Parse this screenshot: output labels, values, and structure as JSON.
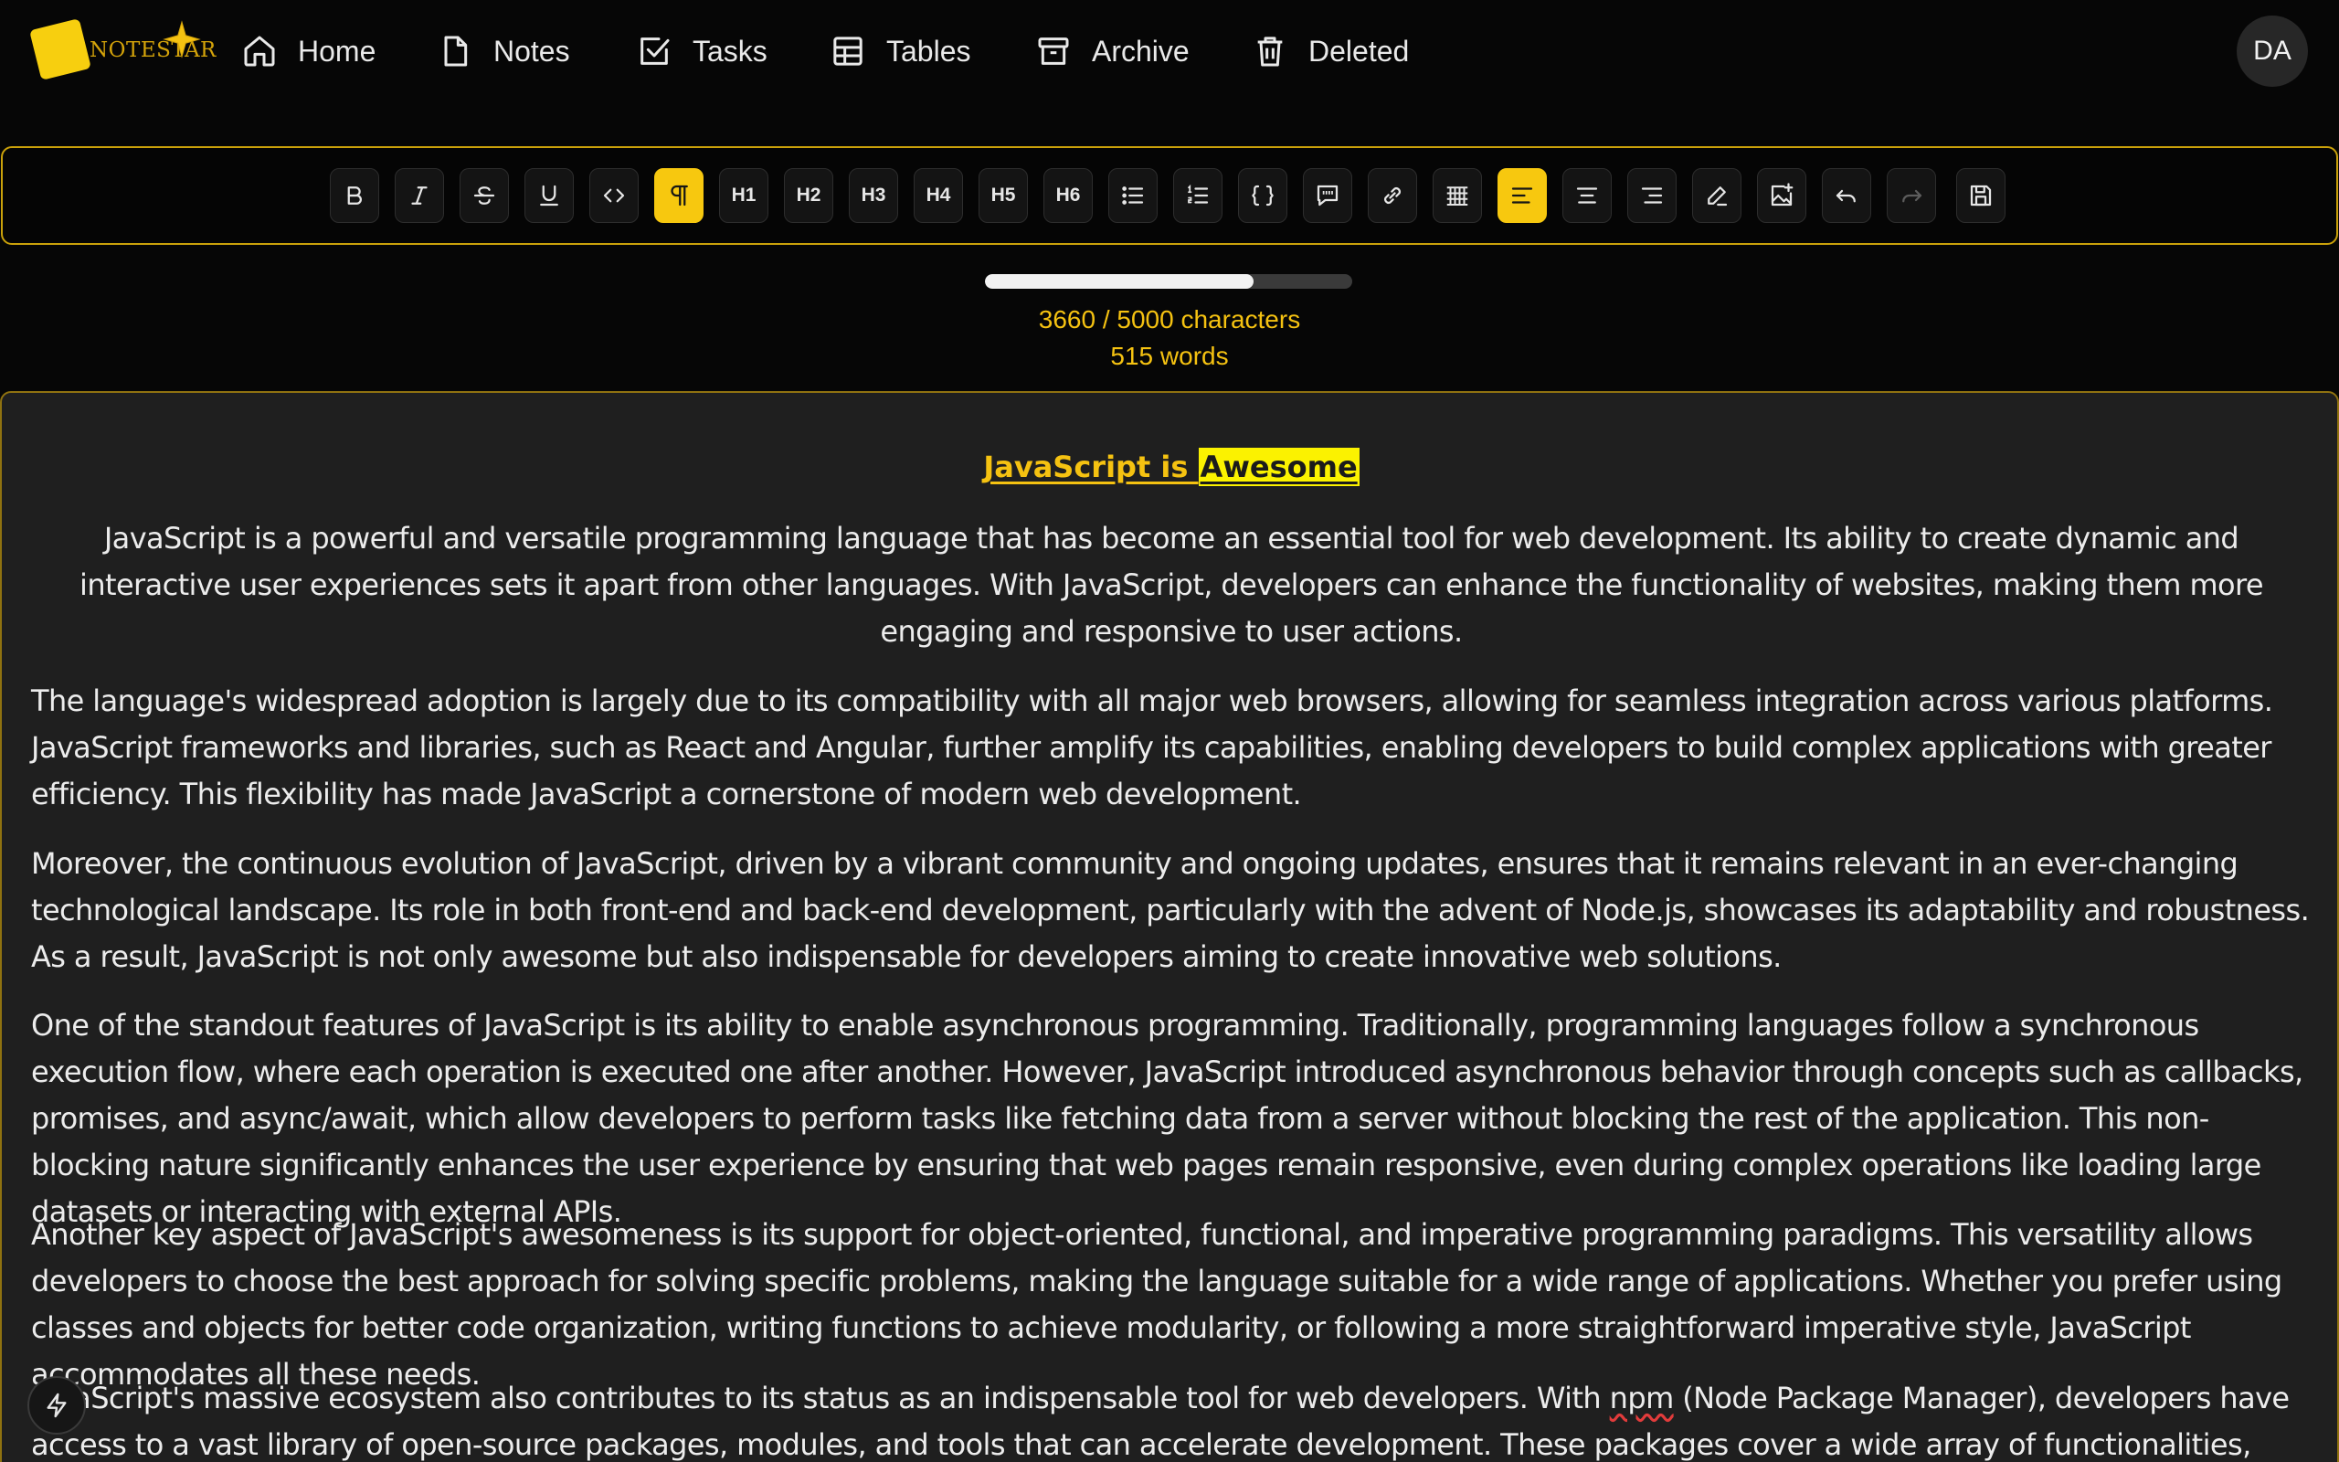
{
  "app": {
    "logo_text": "NOTESTAR",
    "avatar": "DA"
  },
  "nav": [
    {
      "label": "Home",
      "icon": "home-icon"
    },
    {
      "label": "Notes",
      "icon": "note-icon"
    },
    {
      "label": "Tasks",
      "icon": "checkbox-icon"
    },
    {
      "label": "Tables",
      "icon": "table-icon"
    },
    {
      "label": "Archive",
      "icon": "archive-icon"
    },
    {
      "label": "Deleted",
      "icon": "trash-icon"
    }
  ],
  "toolbar": {
    "buttons": [
      "bold",
      "italic",
      "strikethrough",
      "underline",
      "code",
      "paragraph",
      "h1",
      "h2",
      "h3",
      "h4",
      "h5",
      "h6",
      "bullet-list",
      "ordered-list",
      "code-block",
      "blockquote",
      "link",
      "table",
      "align-left",
      "align-center",
      "align-right",
      "highlight",
      "insert-image",
      "undo",
      "redo",
      "save"
    ],
    "headings": [
      "H1",
      "H2",
      "H3",
      "H4",
      "H5",
      "H6"
    ],
    "active": [
      "paragraph",
      "align-left"
    ],
    "disabled": [
      "redo"
    ]
  },
  "stats": {
    "characters_used": 3660,
    "characters_max": 5000,
    "characters_text": "3660 / 5000 characters",
    "words_text": "515 words",
    "progress_fraction": 0.732
  },
  "document": {
    "title_part1": "JavaScript is ",
    "title_highlight": "Awesome",
    "intro": "JavaScript is a powerful and versatile programming language that has become an essential tool for web development. Its ability to create dynamic and interactive user experiences sets it apart from other languages. With JavaScript, developers can enhance the functionality of websites, making them more engaging and responsive to user actions.",
    "p1": "The language's widespread adoption is largely due to its compatibility with all major web browsers, allowing for seamless integration across various platforms. JavaScript frameworks and libraries, such as React and Angular, further amplify its capabilities, enabling developers to build complex applications with greater efficiency. This flexibility has made JavaScript a cornerstone of modern web development.",
    "p2": "Moreover, the continuous evolution of JavaScript, driven by a vibrant community and ongoing updates, ensures that it remains relevant in an ever-changing technological landscape. Its role in both front-end and back-end development, particularly with the advent of Node.js, showcases its adaptability and robustness. As a result, JavaScript is not only awesome but also indispensable for developers aiming to create innovative web solutions.",
    "p3": "One of the standout features of JavaScript is its ability to enable asynchronous programming. Traditionally, programming languages follow a synchronous execution flow, where each operation is executed one after another. However, JavaScript introduced asynchronous behavior through concepts such as callbacks, promises, and async/await, which allow developers to perform tasks like fetching data from a server without blocking the rest of the application. This non-blocking nature significantly enhances the user experience by ensuring that web pages remain responsive, even during complex operations like loading large datasets or interacting with external APIs.",
    "p4": "Another key aspect of JavaScript's awesomeness is its support for object-oriented, functional, and imperative programming paradigms. This versatility allows developers to choose the best approach for solving specific problems, making the language suitable for a wide range of applications. Whether you prefer using classes and objects for better code organization, writing functions to achieve modularity, or following a more straightforward imperative style, JavaScript accommodates all these needs.",
    "p5_before": "JavaScript's massive ecosystem also contributes to its status as an indispensable tool for web developers. With ",
    "p5_spell": "npm",
    "p5_after": " (Node Package Manager), developers have access to a vast library of open-source packages, modules, and tools that can accelerate development. These packages cover a wide array of functionalities, from basic utilities to advanced"
  },
  "colors": {
    "accent": "#f7c80f",
    "background": "#060606",
    "editor_bg": "#1f1f1f",
    "highlight": "#fbf200"
  }
}
